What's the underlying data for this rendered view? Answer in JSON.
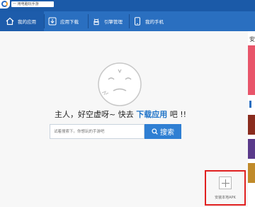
{
  "app": {
    "subtitle": "一 用电脑玩手游"
  },
  "nav": {
    "tabs": [
      {
        "label": "我的应用",
        "icon": "home-icon",
        "active": true
      },
      {
        "label": "应用下载",
        "icon": "download-icon",
        "active": false
      },
      {
        "label": "引擎管理",
        "icon": "android-icon",
        "active": false
      },
      {
        "label": "我的手机",
        "icon": "phone-icon",
        "active": false
      }
    ]
  },
  "main": {
    "message_prefix": "主人，好空虚呀~ 快去 ",
    "message_link": "下载应用",
    "message_suffix": " 吧 !!",
    "search": {
      "placeholder": "试着搜索下。你想玩的手游吧",
      "button_label": "搜索"
    },
    "install": {
      "label": "安装本地APK"
    }
  },
  "right_panel": {
    "header": "安"
  },
  "colors": {
    "nav_bg": "#2a6fc0",
    "accent": "#2f7fd3",
    "link": "#1e73c8",
    "highlight_border": "#e02020"
  }
}
